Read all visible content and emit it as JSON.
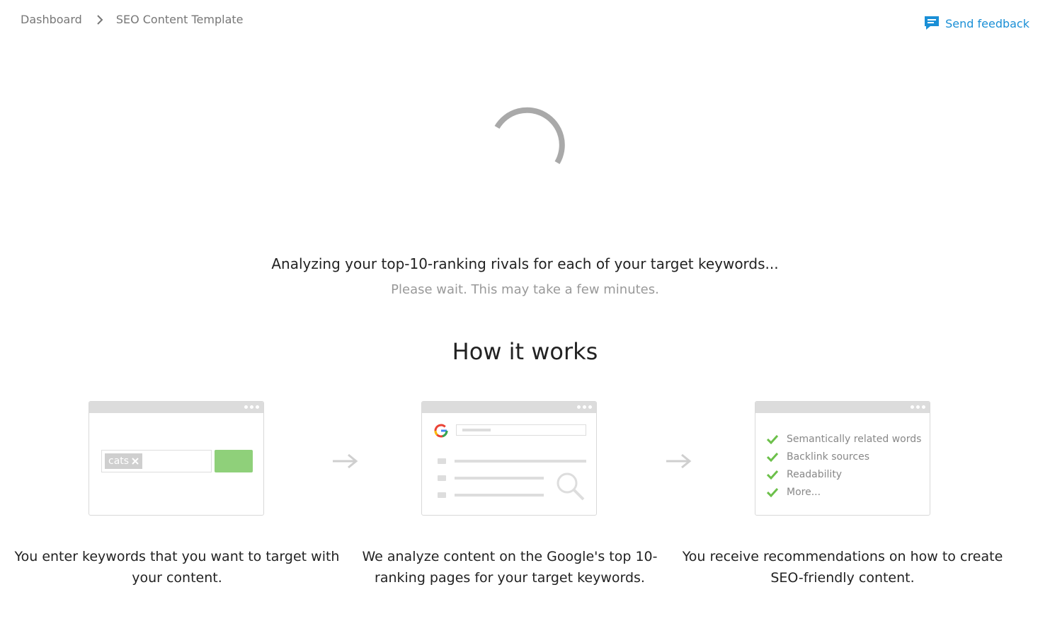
{
  "breadcrumb": {
    "items": [
      "Dashboard",
      "SEO Content Template"
    ]
  },
  "feedback": {
    "label": "Send feedback"
  },
  "status": {
    "title": "Analyzing your top-10-ranking rivals for each of your target keywords...",
    "subtitle": "Please wait. This may take a few minutes."
  },
  "how_it_works": {
    "title": "How it works",
    "keyword_chip": "cats",
    "recommendations": [
      "Semantically related words",
      "Backlink sources",
      "Readability",
      "More..."
    ],
    "steps": [
      "You enter keywords that you want to target with your content.",
      "We analyze content on the Google's top 10-ranking pages for your target keywords.",
      "You receive recommendations on how to create SEO-friendly content."
    ]
  },
  "colors": {
    "accent_blue": "#1a8fd6",
    "button_green": "#8fd07a",
    "check_green": "#6cc04a",
    "spinner_gray": "#a9a9a9"
  }
}
